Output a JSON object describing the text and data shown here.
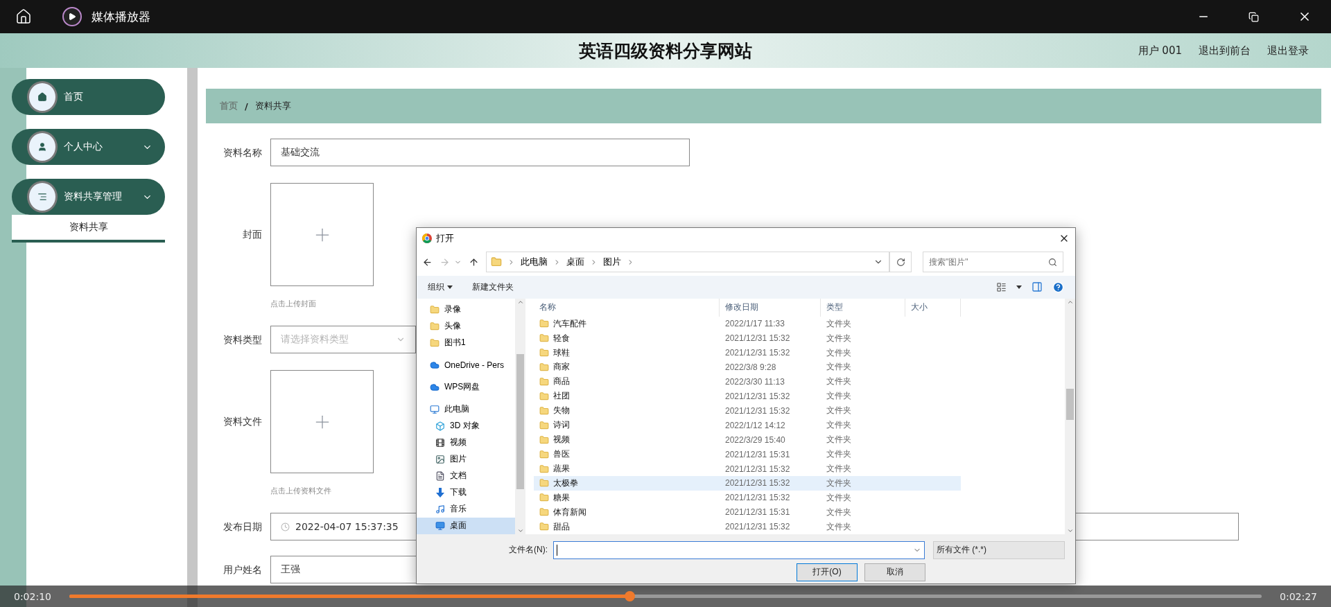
{
  "player": {
    "title": "媒体播放器",
    "elapsed": "0:02:10",
    "total": "0:02:27",
    "level": 0.47
  },
  "site": {
    "title": "英语四级资料分享网站",
    "user": "用户 001",
    "links": [
      "退出到前台",
      "退出登录"
    ]
  },
  "sidebar": {
    "items": [
      {
        "label": "首页",
        "kind": "link"
      },
      {
        "label": "个人中心",
        "kind": "menu"
      },
      {
        "label": "资料共享管理",
        "kind": "menu",
        "children": [
          {
            "label": "资料共享",
            "selected": true
          }
        ]
      }
    ]
  },
  "breadcrumb": {
    "items": [
      "首页",
      "资料共享"
    ],
    "separator": "/"
  },
  "form": {
    "fields": [
      {
        "kind": "text",
        "label": "资料名称",
        "value": "基础交流"
      },
      {
        "kind": "upload",
        "label": "封面",
        "hint": "点击上传封面"
      },
      {
        "kind": "select",
        "label": "资料类型",
        "placeholder": "请选择资料类型"
      },
      {
        "kind": "upload",
        "label": "资料文件",
        "hint": "点击上传资料文件"
      },
      {
        "kind": "date",
        "label": "发布日期",
        "value": "2022-04-07 15:37:35"
      },
      {
        "kind": "text",
        "label": "用户姓名",
        "value": "王强"
      }
    ]
  },
  "dialog": {
    "title": "打开",
    "path": [
      "此电脑",
      "桌面",
      "图片"
    ],
    "search_placeholder": "搜索\"图片\"",
    "toolbar": [
      "组织",
      "新建文件夹"
    ],
    "nav": [
      {
        "label": "录像",
        "selected": false
      },
      {
        "label": "头像",
        "selected": false
      },
      {
        "label": "图书1",
        "selected": false
      },
      {
        "label": "OneDrive - Pers",
        "selected": false
      },
      {
        "label": "WPS网盘",
        "selected": false
      },
      {
        "label": "此电脑",
        "selected": false,
        "children": [
          {
            "label": "3D 对象",
            "selected": false
          },
          {
            "label": "视频",
            "selected": false
          },
          {
            "label": "图片",
            "selected": false
          },
          {
            "label": "文档",
            "selected": false
          },
          {
            "label": "下载",
            "selected": false
          },
          {
            "label": "音乐",
            "selected": false
          },
          {
            "label": "桌面",
            "selected": true
          }
        ]
      }
    ],
    "columns": [
      "名称",
      "修改日期",
      "类型",
      "大小"
    ],
    "files": [
      {
        "name": "汽车配件",
        "modified": "2022/1/17 11:33",
        "type": "文件夹",
        "selected": false
      },
      {
        "name": "轻食",
        "modified": "2021/12/31 15:32",
        "type": "文件夹",
        "selected": false
      },
      {
        "name": "球鞋",
        "modified": "2021/12/31 15:32",
        "type": "文件夹",
        "selected": false
      },
      {
        "name": "商家",
        "modified": "2022/3/8 9:28",
        "type": "文件夹",
        "selected": false
      },
      {
        "name": "商品",
        "modified": "2022/3/30 11:13",
        "type": "文件夹",
        "selected": false
      },
      {
        "name": "社团",
        "modified": "2021/12/31 15:32",
        "type": "文件夹",
        "selected": false
      },
      {
        "name": "失物",
        "modified": "2021/12/31 15:32",
        "type": "文件夹",
        "selected": false
      },
      {
        "name": "诗词",
        "modified": "2022/1/12 14:12",
        "type": "文件夹",
        "selected": false
      },
      {
        "name": "视频",
        "modified": "2022/3/29 15:40",
        "type": "文件夹",
        "selected": false
      },
      {
        "name": "兽医",
        "modified": "2021/12/31 15:31",
        "type": "文件夹",
        "selected": false
      },
      {
        "name": "蔬果",
        "modified": "2021/12/31 15:32",
        "type": "文件夹",
        "selected": false
      },
      {
        "name": "太极拳",
        "modified": "2021/12/31 15:32",
        "type": "文件夹",
        "selected": true
      },
      {
        "name": "糖果",
        "modified": "2021/12/31 15:32",
        "type": "文件夹",
        "selected": false
      },
      {
        "name": "体育新闻",
        "modified": "2021/12/31 15:31",
        "type": "文件夹",
        "selected": false
      },
      {
        "name": "甜品",
        "modified": "2021/12/31 15:32",
        "type": "文件夹",
        "selected": false
      }
    ],
    "filename_label": "文件名(N):",
    "filter": "所有文件 (*.*)",
    "buttons": [
      "打开(O)",
      "取消"
    ]
  }
}
